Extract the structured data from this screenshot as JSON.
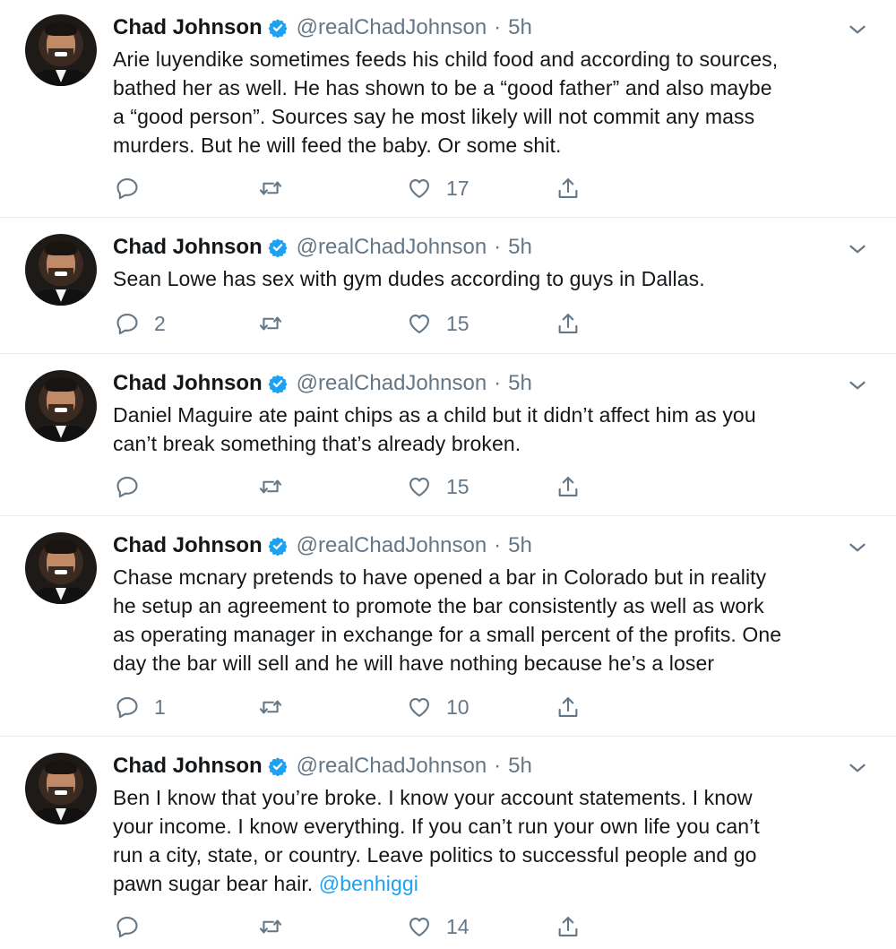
{
  "tweets": [
    {
      "name": "Chad Johnson",
      "handle": "@realChadJohnson",
      "dot": "·",
      "time": "5h",
      "lines": [
        "Arie luyendike sometimes feeds his child food and according to sources,",
        "bathed her as well. He has shown to be a “good father” and also maybe",
        "a “good person”. Sources say he most likely will not commit any mass",
        "murders. But he will feed the baby. Or some shit."
      ],
      "mention": "",
      "replies": "",
      "likes": "17"
    },
    {
      "name": "Chad Johnson",
      "handle": "@realChadJohnson",
      "dot": "·",
      "time": "5h",
      "lines": [
        "Sean Lowe has sex with gym dudes according to guys in Dallas."
      ],
      "mention": "",
      "replies": "2",
      "likes": "15"
    },
    {
      "name": "Chad Johnson",
      "handle": "@realChadJohnson",
      "dot": "·",
      "time": "5h",
      "lines": [
        "Daniel Maguire ate paint chips as a child but it didn’t affect him as you",
        "can’t break something that’s already broken."
      ],
      "mention": "",
      "replies": "",
      "likes": "15"
    },
    {
      "name": "Chad Johnson",
      "handle": "@realChadJohnson",
      "dot": "·",
      "time": "5h",
      "lines": [
        "Chase mcnary pretends to have opened a bar in Colorado but in reality",
        "he setup an agreement to promote the bar consistently as well as work",
        "as operating manager in exchange for a small percent of the profits. One",
        "day the bar will sell and he will have nothing because he’s a loser"
      ],
      "mention": "",
      "replies": "1",
      "likes": "10"
    },
    {
      "name": "Chad Johnson",
      "handle": "@realChadJohnson",
      "dot": "·",
      "time": "5h",
      "lines": [
        "Ben I know that you’re broke. I know your account statements. I know",
        "your income. I know everything. If you can’t run your own life you can’t",
        "run a city, state, or country. Leave politics to successful people and go",
        "pawn sugar bear hair."
      ],
      "mention": "@benhiggi",
      "replies": "",
      "likes": "14"
    }
  ],
  "colors": {
    "verified": "#1da1f2",
    "mention": "#1da1f2",
    "secondary_text": "#657786",
    "divider": "#e6ecf0"
  },
  "icons": [
    "verified-badge-icon",
    "chevron-down-icon",
    "reply-icon",
    "retweet-icon",
    "like-icon",
    "share-icon"
  ]
}
